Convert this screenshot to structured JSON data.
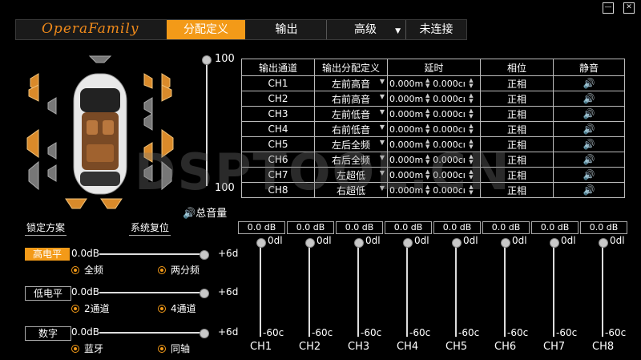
{
  "window": {
    "minimize_icon": "minimize-icon",
    "close_icon": "close-icon"
  },
  "nav": {
    "logo": "OperaFamily",
    "tabs": [
      {
        "label": "分配定义",
        "active": true
      },
      {
        "label": "输出",
        "active": false
      },
      {
        "label": "高级",
        "active": false
      },
      {
        "label": "未连接",
        "active": false
      }
    ]
  },
  "colors": {
    "accent": "#f39a18",
    "background": "#000000"
  },
  "master": {
    "max_label": "100",
    "min_label": "100",
    "volume_label": "总音量",
    "level": 1.0
  },
  "buttons": {
    "lock": "锁定方案",
    "reset": "系统复位"
  },
  "table": {
    "headers": [
      "输出通道",
      "输出分配定义",
      "延时",
      "相位",
      "静音"
    ],
    "rows": [
      {
        "ch": "CH1",
        "assign": "左前高音",
        "delay1": "0.000m",
        "delay2": "0.000cı",
        "phase": "正相"
      },
      {
        "ch": "CH2",
        "assign": "右前高音",
        "delay1": "0.000m",
        "delay2": "0.000cı",
        "phase": "正相"
      },
      {
        "ch": "CH3",
        "assign": "左前低音",
        "delay1": "0.000m",
        "delay2": "0.000cı",
        "phase": "正相"
      },
      {
        "ch": "CH4",
        "assign": "右前低音",
        "delay1": "0.000m",
        "delay2": "0.000cı",
        "phase": "正相"
      },
      {
        "ch": "CH5",
        "assign": "左后全频",
        "delay1": "0.000m",
        "delay2": "0.000cı",
        "phase": "正相"
      },
      {
        "ch": "CH6",
        "assign": "右后全频",
        "delay1": "0.000m",
        "delay2": "0.000cı",
        "phase": "正相"
      },
      {
        "ch": "CH7",
        "assign": "左超低",
        "delay1": "0.000m",
        "delay2": "0.000cı",
        "phase": "正相"
      },
      {
        "ch": "CH8",
        "assign": "右超低",
        "delay1": "0.000m",
        "delay2": "0.000cı",
        "phase": "正相"
      }
    ]
  },
  "inputs": [
    {
      "tag": "高电平",
      "active": true,
      "min": "0.0dB",
      "max": "+6d",
      "level": 1.0,
      "opt1": "全频",
      "opt2": "两分频"
    },
    {
      "tag": "低电平",
      "active": false,
      "min": "0.0dB",
      "max": "+6d",
      "level": 1.0,
      "opt1": "2通道",
      "opt2": "4通道"
    },
    {
      "tag": "数字",
      "active": false,
      "min": "0.0dB",
      "max": "+6d",
      "level": 1.0,
      "opt1": "蓝牙",
      "opt2": "同轴"
    }
  ],
  "channels": [
    {
      "name": "CH1",
      "db": "0.0 dB",
      "top": "0dl",
      "bottom": "-60c",
      "level": 1.0
    },
    {
      "name": "CH2",
      "db": "0.0 dB",
      "top": "0dl",
      "bottom": "-60c",
      "level": 1.0
    },
    {
      "name": "CH3",
      "db": "0.0 dB",
      "top": "0dl",
      "bottom": "-60c",
      "level": 1.0
    },
    {
      "name": "CH4",
      "db": "0.0 dB",
      "top": "0dl",
      "bottom": "-60c",
      "level": 1.0
    },
    {
      "name": "CH5",
      "db": "0.0 dB",
      "top": "0dl",
      "bottom": "-60c",
      "level": 1.0
    },
    {
      "name": "CH6",
      "db": "0.0 dB",
      "top": "0dl",
      "bottom": "-60c",
      "level": 1.0
    },
    {
      "name": "CH7",
      "db": "0.0 dB",
      "top": "0dl",
      "bottom": "-60c",
      "level": 1.0
    },
    {
      "name": "CH8",
      "db": "0.0 dB",
      "top": "0dl",
      "bottom": "-60c",
      "level": 1.0
    }
  ],
  "watermark": "DSPTOOL.CN"
}
